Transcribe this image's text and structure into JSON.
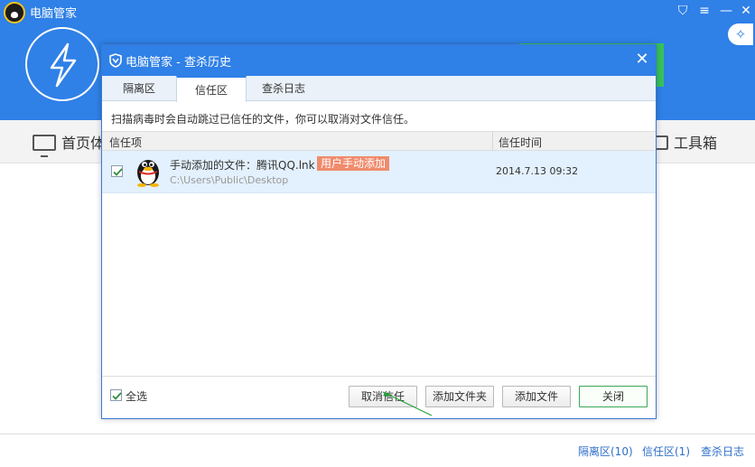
{
  "app": {
    "title": "电脑管家"
  },
  "nav": {
    "home": "首页体",
    "tools": "工具箱"
  },
  "dialog": {
    "title": "电脑管家 - 查杀历史",
    "tabs": [
      {
        "label": "隔离区"
      },
      {
        "label": "信任区"
      },
      {
        "label": "查杀日志"
      }
    ],
    "description": "扫描病毒时会自动跳过已信任的文件，你可以取消对文件信任。",
    "columns": {
      "item": "信任项",
      "time": "信任时间"
    },
    "rows": [
      {
        "name": "手动添加的文件：腾讯QQ.lnk",
        "badge": "用户手动添加",
        "path": "C:\\Users\\Public\\Desktop",
        "time": "2014.7.13 09:32"
      }
    ],
    "select_all": "全选",
    "buttons": {
      "cancel_trust": "取消信任",
      "add_folder": "添加文件夹",
      "add_file": "添加文件",
      "close": "关闭"
    }
  },
  "footer": {
    "quarantine": "隔离区(10)",
    "trust": "信任区(1)",
    "log": "查杀日志"
  },
  "colors": {
    "brand_blue": "#2f80e7",
    "badge": "#f08b6c",
    "row_selected": "#e3f0fd",
    "primary_border": "#3aa757"
  }
}
